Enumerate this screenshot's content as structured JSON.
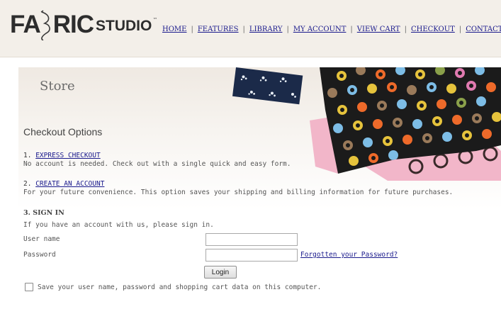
{
  "header": {
    "logo": {
      "part1": "FA",
      "part2": "RIC",
      "part3": "STUDIO",
      "tm": "™"
    },
    "nav": [
      {
        "label": "HOME"
      },
      {
        "label": "FEATURES"
      },
      {
        "label": "LIBRARY"
      },
      {
        "label": "MY ACCOUNT"
      },
      {
        "label": "VIEW CART"
      },
      {
        "label": "CHECKOUT"
      },
      {
        "label": "CONTACT US"
      }
    ],
    "separator": "|"
  },
  "page": {
    "title": "Store",
    "section_title": "Checkout Options"
  },
  "options": {
    "express": {
      "number": "1.",
      "link": "EXPRESS CHECKOUT",
      "desc": "No account is needed. Check out with a single quick and easy form."
    },
    "create": {
      "number": "2.",
      "link": "CREATE AN ACCOUNT",
      "desc": "For your future convenience. This option saves your shipping and billing information for future purchases."
    },
    "signin": {
      "heading": "3. SIGN IN",
      "desc": "If you have an account with us, please sign in.",
      "username_label": "User name",
      "username_value": "",
      "password_label": "Password",
      "password_value": "",
      "forgot_link": "Forgotten your Password?",
      "login_button": "Login",
      "remember_label": "Save your user name, password and shopping cart data on this computer.",
      "remember_checked": false
    }
  },
  "colors": {
    "link": "#1a1a8c",
    "header_bg": "#f3efe9",
    "fabric_dark": "#1b1b1b"
  }
}
